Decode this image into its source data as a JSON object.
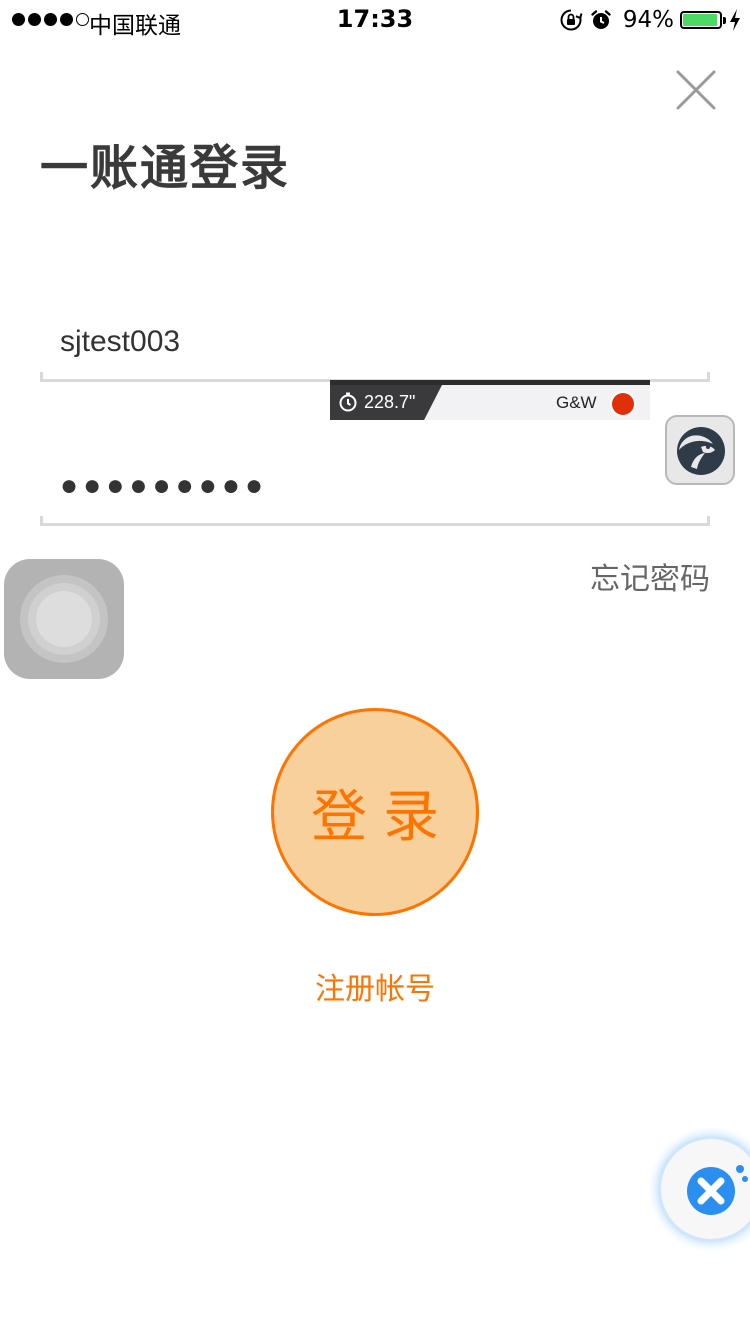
{
  "status_bar": {
    "carrier": "中国联通",
    "time": "17:33",
    "battery_percent": "94%",
    "battery_level": 0.94,
    "signal_bars": 4,
    "signal_total": 5,
    "battery_color": "#4cd964"
  },
  "header": {
    "title": "一账通登录",
    "close_icon": "close-icon"
  },
  "form": {
    "username_value": "sjtest003",
    "password_masked": "●●●●●●●●●",
    "forgot_password_label": "忘记密码",
    "login_button_label": "登录",
    "register_label": "注册帐号"
  },
  "overlay": {
    "timer_text": "228.7\"",
    "label": "G&W"
  },
  "colors": {
    "accent": "#ff7400",
    "login_fill": "#f8d09c",
    "record_dot": "#e0300a",
    "tool_blue": "#2a8ff0"
  },
  "icons": {
    "stopwatch": "stopwatch-icon",
    "bird_app": "bird-app-icon",
    "assistive_touch": "assistive-touch-icon",
    "tool": "tool-wrench-icon"
  }
}
